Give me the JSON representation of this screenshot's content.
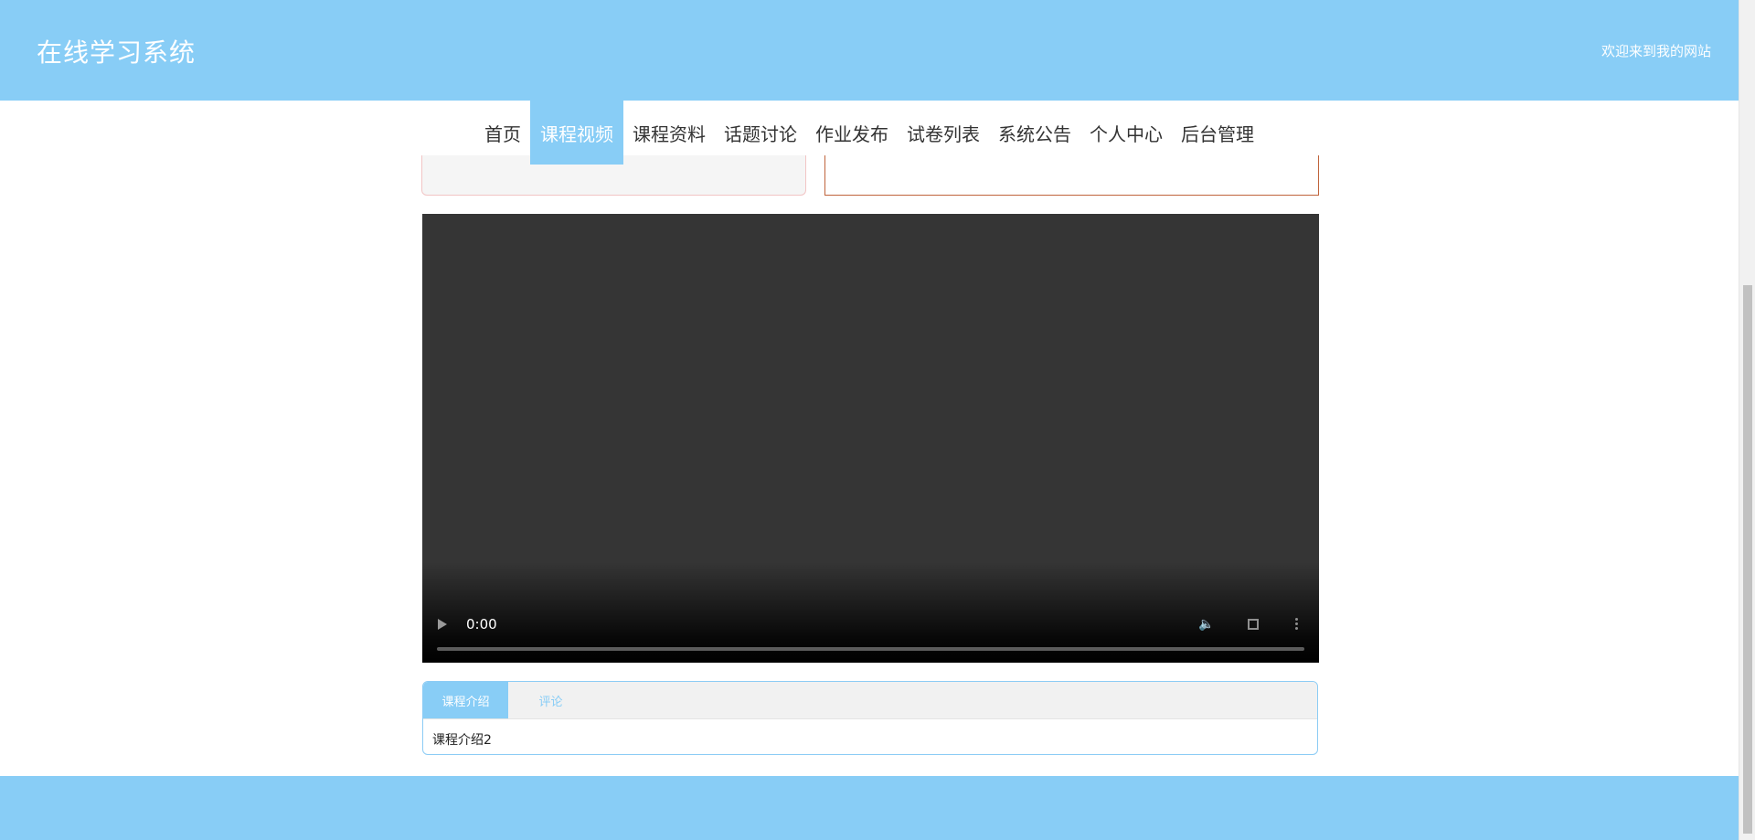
{
  "header": {
    "title": "在线学习系统",
    "welcome": "欢迎来到我的网站"
  },
  "nav": {
    "items": [
      {
        "label": "首页",
        "active": false
      },
      {
        "label": "课程视频",
        "active": true
      },
      {
        "label": "课程资料",
        "active": false
      },
      {
        "label": "话题讨论",
        "active": false
      },
      {
        "label": "作业发布",
        "active": false
      },
      {
        "label": "试卷列表",
        "active": false
      },
      {
        "label": "系统公告",
        "active": false
      },
      {
        "label": "个人中心",
        "active": false
      },
      {
        "label": "后台管理",
        "active": false
      }
    ]
  },
  "video": {
    "time": "0:00",
    "play_icon": "play-icon",
    "volume_icon": "volume-icon",
    "fullscreen_icon": "fullscreen-icon",
    "more_icon": "more-options-icon"
  },
  "tabs": {
    "items": [
      {
        "label": "课程介绍",
        "active": true
      },
      {
        "label": "评论",
        "active": false
      }
    ],
    "content": "课程介绍2"
  },
  "colors": {
    "brand": "#88cdf6",
    "text": "#333333",
    "video_bg": "#353535"
  }
}
